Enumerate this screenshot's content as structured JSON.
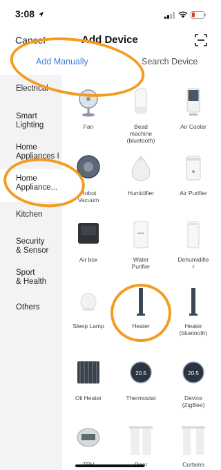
{
  "status_bar": {
    "time": "3:08",
    "location_icon": "location-arrow-icon",
    "signal_icon": "signal-icon",
    "wifi_icon": "wifi-icon",
    "battery_icon": "battery-icon"
  },
  "nav": {
    "cancel": "Cancel",
    "title": "Add Device",
    "scan_icon": "scan-icon"
  },
  "tabs": [
    {
      "label": "Add Manually",
      "active": true
    },
    {
      "label": "Search Device",
      "active": false
    }
  ],
  "sidebar": {
    "items": [
      {
        "label": "Electrical"
      },
      {
        "label": "Smart\nLighting"
      },
      {
        "label": "Home\nAppliances I"
      },
      {
        "label": "Home\nAppliance...",
        "active": true
      },
      {
        "label": "Kitchen"
      },
      {
        "label": "Security\n& Sensor"
      },
      {
        "label": "Sport\n& Health"
      },
      {
        "label": "Others"
      }
    ]
  },
  "devices": [
    {
      "label": "Fan",
      "icon": "fan-icon"
    },
    {
      "label": "Bead\nmachine\n(bluetooth)",
      "icon": "bead-machine-icon"
    },
    {
      "label": "Air Cooler",
      "icon": "air-cooler-icon"
    },
    {
      "label": "Robot\nVacuum",
      "icon": "robot-vacuum-icon"
    },
    {
      "label": "Humidifier",
      "icon": "humidifier-icon"
    },
    {
      "label": "Air Purifier",
      "icon": "air-purifier-icon"
    },
    {
      "label": "Air box",
      "icon": "air-box-icon"
    },
    {
      "label": "Water\nPurifier",
      "icon": "water-purifier-icon"
    },
    {
      "label": "Dehumidifie\nr",
      "icon": "dehumidifier-icon"
    },
    {
      "label": "Sleep Lamp",
      "icon": "sleep-lamp-icon"
    },
    {
      "label": "Heater",
      "icon": "heater-icon"
    },
    {
      "label": "Heater\n(bluetooth)",
      "icon": "heater-bluetooth-icon"
    },
    {
      "label": "Oil Heater",
      "icon": "oil-heater-icon"
    },
    {
      "label": "Thermostat",
      "icon": "thermostat-icon",
      "display": "20.5"
    },
    {
      "label": "Device\n(ZigBee)",
      "icon": "thermostat-zigbee-icon",
      "display": "20.5"
    },
    {
      "label": "TRV",
      "icon": "trv-icon"
    },
    {
      "label": "Door",
      "icon": "door-curtain-icon"
    },
    {
      "label": "Curtains",
      "icon": "curtains-icon"
    }
  ],
  "colors": {
    "accent": "#3f7fdc",
    "annotation": "#f39c1f",
    "sidebar_bg": "#f3f3f5"
  }
}
